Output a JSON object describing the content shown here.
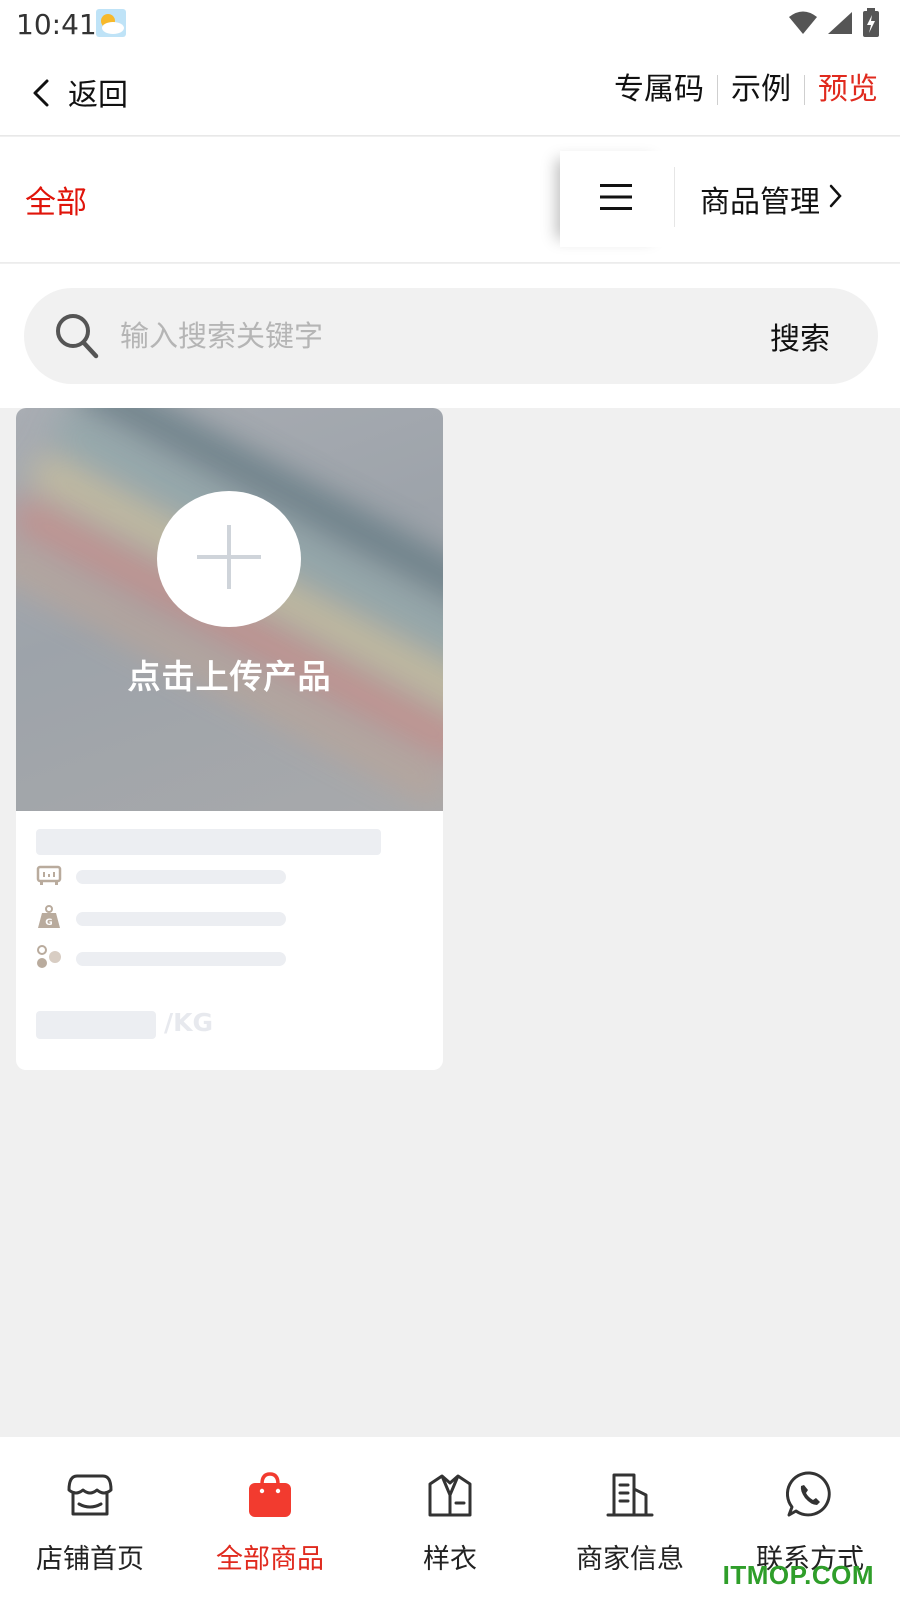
{
  "status_bar": {
    "time": "10:41"
  },
  "header": {
    "back_label": "返回",
    "actions": [
      "专属码",
      "示例",
      "预览"
    ]
  },
  "category_bar": {
    "selected": "全部",
    "manage_label": "商品管理"
  },
  "search": {
    "placeholder": "输入搜索关键字",
    "button_label": "搜索"
  },
  "product_card": {
    "upload_label": "点击上传产品",
    "price_unit": "/KG"
  },
  "bottom_nav": [
    {
      "label": "店铺首页",
      "icon": "store-icon"
    },
    {
      "label": "全部商品",
      "icon": "shopping-bag-icon",
      "active": true
    },
    {
      "label": "样衣",
      "icon": "shirt-box-icon"
    },
    {
      "label": "商家信息",
      "icon": "building-icon"
    },
    {
      "label": "联系方式",
      "icon": "whatsapp-phone-icon"
    }
  ],
  "watermark": "ITMOP.COM",
  "colors": {
    "accent_red": "#e02a1e",
    "watermark_green": "#2f9e2a"
  }
}
